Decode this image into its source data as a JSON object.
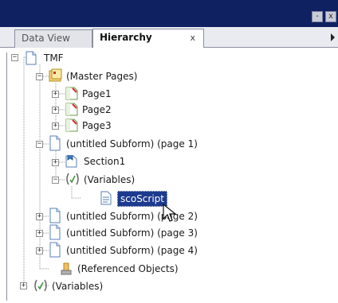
{
  "window": {
    "buttons": [
      "-",
      "x"
    ]
  },
  "tabs": [
    {
      "label": "Data View",
      "active": false
    },
    {
      "label": "Hierarchy",
      "active": true,
      "close": "x"
    }
  ],
  "tree": {
    "root": "TMF",
    "master_pages": "(Master Pages)",
    "pages": [
      "Page1",
      "Page2",
      "Page3"
    ],
    "subform_page1": "(untitled Subform) (page 1)",
    "section": "Section1",
    "variables_inner": "(Variables)",
    "selected_script": "scoScript",
    "subform_page2": "(untitled Subform) (page 2)",
    "subform_page3": "(untitled Subform) (page 3)",
    "subform_page4": "(untitled Subform) (page 4)",
    "referenced": "(Referenced Objects)",
    "variables_outer": "(Variables)"
  },
  "colors": {
    "titlebar": "#0f2161",
    "selection": "#1c3a8e"
  }
}
